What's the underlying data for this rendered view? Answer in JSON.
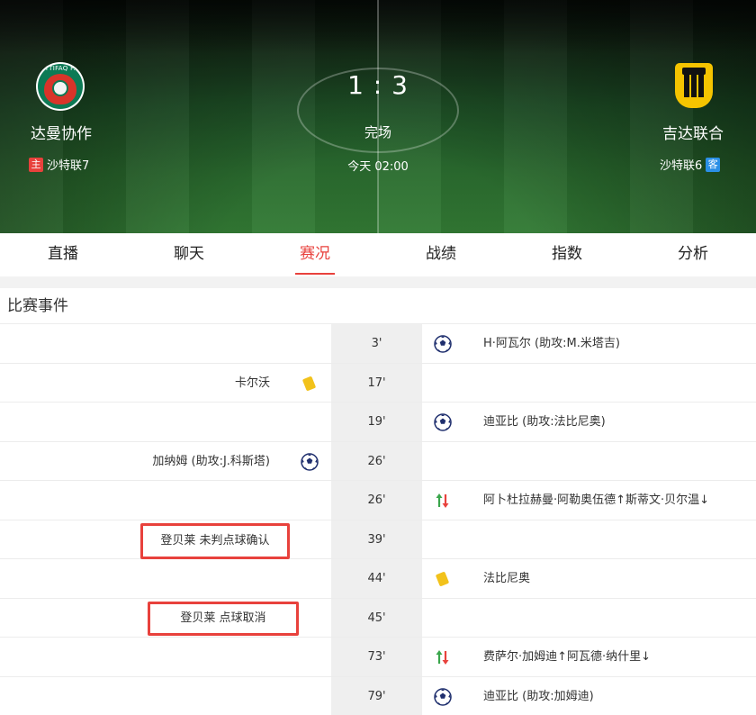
{
  "match": {
    "home_team": "达曼协作",
    "away_team": "吉达联合",
    "score": "1 : 3",
    "status": "完场",
    "time": "今天 02:00",
    "home_tag": "主",
    "away_tag": "客",
    "home_rank": "沙特联7",
    "away_rank": "沙特联6",
    "home_crest_text": "ETTIFAQ F.C",
    "home_crest_icon": "ettifaq-crest-icon",
    "away_crest_icon": "ittihad-crest-icon"
  },
  "tabs": [
    {
      "label": "直播",
      "active": false
    },
    {
      "label": "聊天",
      "active": false
    },
    {
      "label": "赛况",
      "active": true
    },
    {
      "label": "战绩",
      "active": false
    },
    {
      "label": "指数",
      "active": false
    },
    {
      "label": "分析",
      "active": false
    }
  ],
  "events_section": {
    "title": "比赛事件",
    "events": [
      {
        "minute": "3'",
        "side": "away",
        "icon": "goal-icon",
        "text": "H·阿瓦尔 (助攻:M.米塔吉)"
      },
      {
        "minute": "17'",
        "side": "home",
        "icon": "yellow-card-icon",
        "text": "卡尔沃"
      },
      {
        "minute": "19'",
        "side": "away",
        "icon": "goal-icon",
        "text": "迪亚比 (助攻:法比尼奥)"
      },
      {
        "minute": "26'",
        "side": "home",
        "icon": "goal-icon",
        "text": "加纳姆 (助攻:J.科斯塔)"
      },
      {
        "minute": "26'",
        "side": "away",
        "icon": "substitution-icon",
        "text": "阿卜杜拉赫曼·阿勒奥伍德↑斯蒂文·贝尔温↓"
      },
      {
        "minute": "39'",
        "side": "home",
        "icon": "",
        "text": "登贝莱 未判点球确认",
        "highlight": true
      },
      {
        "minute": "44'",
        "side": "away",
        "icon": "yellow-card-icon",
        "text": "法比尼奥"
      },
      {
        "minute": "45'",
        "side": "home",
        "icon": "",
        "text": "登贝莱 点球取消",
        "highlight": true
      },
      {
        "minute": "73'",
        "side": "away",
        "icon": "substitution-icon",
        "text": "费萨尔·加姆迪↑阿瓦德·纳什里↓"
      },
      {
        "minute": "79'",
        "side": "away",
        "icon": "goal-icon",
        "text": "迪亚比 (助攻:加姆迪)"
      }
    ]
  },
  "colors": {
    "accent": "#e8413c",
    "home_tag": "#e8413c",
    "away_tag": "#2b8fe6",
    "yellow_card": "#f2c21b",
    "sub_in": "#3aa64c",
    "sub_out": "#e8413c"
  }
}
